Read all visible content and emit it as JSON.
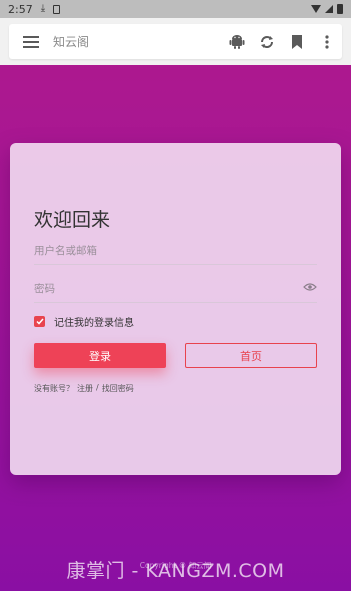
{
  "status_bar": {
    "time": "2:57"
  },
  "browser": {
    "url_text": "知云阁"
  },
  "login": {
    "title": "欢迎回来",
    "username_placeholder": "用户名或邮箱",
    "password_placeholder": "密码",
    "remember_label": "记住我的登录信息",
    "login_button": "登录",
    "home_button": "首页",
    "no_account": "没有账号？",
    "register_link": "注册",
    "separator": "/",
    "recover_link": "找回密码"
  },
  "footer": {
    "copyright": "Copyright © 知云阁"
  },
  "watermark": "康掌门 - KANGZM.COM",
  "colors": {
    "accent": "#ee4257",
    "bg_top": "#b01a8c",
    "bg_bottom": "#8a0fa3"
  }
}
